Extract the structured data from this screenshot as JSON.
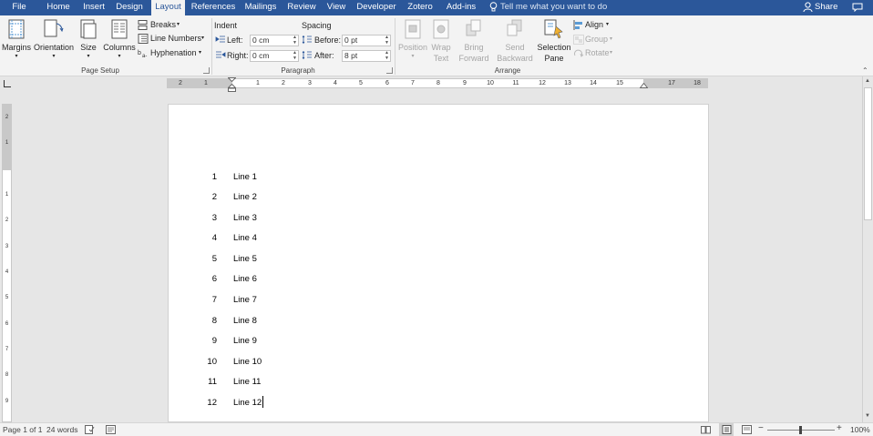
{
  "tabs": [
    "File",
    "Home",
    "Insert",
    "Design",
    "Layout",
    "References",
    "Mailings",
    "Review",
    "View",
    "Developer",
    "Zotero",
    "Add-ins"
  ],
  "active_tab": "Layout",
  "tell_me": "Tell me what you want to do",
  "share": "Share",
  "page_setup": {
    "margins": "Margins",
    "orientation": "Orientation",
    "size": "Size",
    "columns": "Columns",
    "breaks": "Breaks",
    "line_numbers": "Line Numbers",
    "hyphenation": "Hyphenation",
    "group_label": "Page Setup"
  },
  "paragraph": {
    "indent_label": "Indent",
    "left_label": "Left:",
    "left_value": "0 cm",
    "right_label": "Right:",
    "right_value": "0 cm",
    "spacing_label": "Spacing",
    "before_label": "Before:",
    "before_value": "0 pt",
    "after_label": "After:",
    "after_value": "8 pt",
    "group_label": "Paragraph"
  },
  "arrange": {
    "position": "Position",
    "wrap_text_1": "Wrap",
    "wrap_text_2": "Text",
    "bring_forward_1": "Bring",
    "bring_forward_2": "Forward",
    "send_backward_1": "Send",
    "send_backward_2": "Backward",
    "selection_pane_1": "Selection",
    "selection_pane_2": "Pane",
    "align": "Align",
    "group": "Group",
    "rotate": "Rotate",
    "group_label": "Arrange"
  },
  "ruler_ticks": [
    "2",
    "1",
    "1",
    "2",
    "3",
    "4",
    "5",
    "6",
    "7",
    "8",
    "9",
    "10",
    "11",
    "12",
    "13",
    "14",
    "15",
    "17",
    "18"
  ],
  "vruler_ticks": [
    "2",
    "1",
    "1",
    "2",
    "3",
    "4",
    "5",
    "6",
    "7",
    "8",
    "9"
  ],
  "document_lines": [
    {
      "num": "1",
      "text": "Line 1"
    },
    {
      "num": "2",
      "text": "Line 2"
    },
    {
      "num": "3",
      "text": "Line 3"
    },
    {
      "num": "4",
      "text": "Line 4"
    },
    {
      "num": "5",
      "text": "Line 5"
    },
    {
      "num": "6",
      "text": "Line 6"
    },
    {
      "num": "7",
      "text": "Line 7"
    },
    {
      "num": "8",
      "text": "Line 8"
    },
    {
      "num": "9",
      "text": "Line 9"
    },
    {
      "num": "10",
      "text": "Line 10"
    },
    {
      "num": "11",
      "text": "Line 11"
    },
    {
      "num": "12",
      "text": "Line 12"
    }
  ],
  "status": {
    "page": "Page 1 of 1",
    "words": "24 words",
    "zoom": "100%"
  },
  "colors": {
    "accent": "#2b579a",
    "ribbon": "#f3f3f3",
    "canvas": "#e6e6e6"
  },
  "icons": [
    "lightbulb-icon",
    "person-icon",
    "comment-icon",
    "proofing-icon",
    "macro-icon",
    "read-mode-icon",
    "print-layout-icon",
    "web-layout-icon"
  ]
}
